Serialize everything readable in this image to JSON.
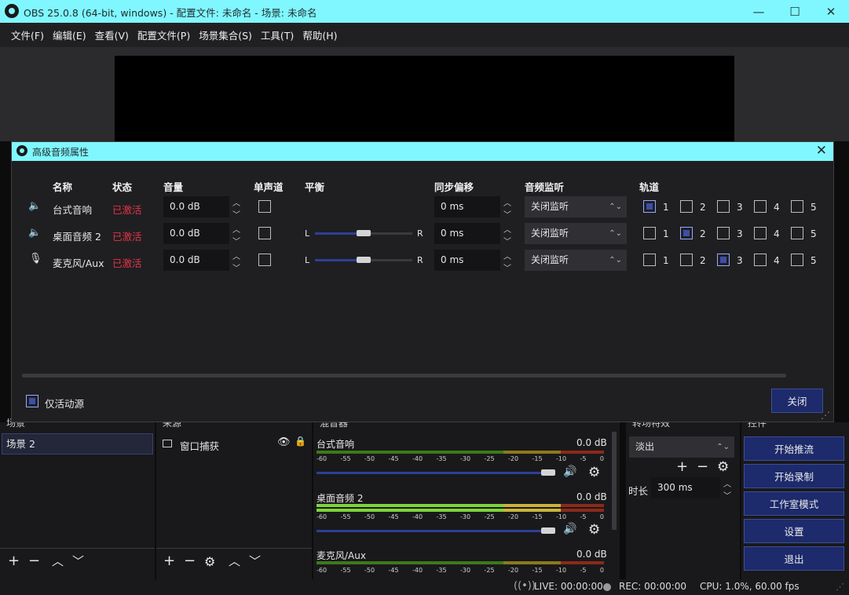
{
  "window": {
    "title": "OBS 25.0.8 (64-bit, windows) - 配置文件: 未命名 - 场景: 未命名",
    "minimize": "—",
    "maximize": "☐",
    "close": "✕"
  },
  "menu": [
    "文件(F)",
    "编辑(E)",
    "查看(V)",
    "配置文件(P)",
    "场景集合(S)",
    "工具(T)",
    "帮助(H)"
  ],
  "dialog": {
    "title": "高级音频属性",
    "close_icon": "✕",
    "headers": {
      "name": "名称",
      "status": "状态",
      "volume": "音量",
      "mono": "单声道",
      "balance": "平衡",
      "sync": "同步偏移",
      "monitoring": "音频监听",
      "tracks": "轨道"
    },
    "rows": [
      {
        "icon": "speaker-icon",
        "name": "台式音响",
        "status": "已激活",
        "volume": "0.0 dB",
        "sync": "0 ms",
        "monitor": "关闭监听",
        "balance": false,
        "track_on": 1
      },
      {
        "icon": "speaker-icon",
        "name": "桌面音频 2",
        "status": "已激活",
        "volume": "0.0 dB",
        "sync": "0 ms",
        "monitor": "关闭监听",
        "balance": true,
        "track_on": 2
      },
      {
        "icon": "microphone-icon",
        "name": "麦克风/Aux",
        "status": "已激活",
        "volume": "0.0 dB",
        "sync": "0 ms",
        "monitor": "关闭监听",
        "balance": true,
        "track_on": 3
      }
    ],
    "balance_left": "L",
    "balance_right": "R",
    "track_labels": [
      "1",
      "2",
      "3",
      "4",
      "5"
    ],
    "active_only_label": "仅活动源",
    "close_button": "关闭"
  },
  "scenes": {
    "header": "场景",
    "items": [
      "场景 2"
    ]
  },
  "sources": {
    "header": "来源",
    "items": [
      "窗口捕获"
    ]
  },
  "mixer": {
    "header": "混音器",
    "channels": [
      {
        "name": "台式音响",
        "db": "0.0 dB",
        "level": 0.97
      },
      {
        "name": "桌面音频 2",
        "db": "0.0 dB",
        "level": 0.97
      },
      {
        "name": "麦克风/Aux",
        "db": "0.0 dB",
        "level": 0.97
      }
    ],
    "scale": [
      "-60",
      "-55",
      "-50",
      "-45",
      "-40",
      "-35",
      "-30",
      "-25",
      "-20",
      "-15",
      "-10",
      "-5",
      "0"
    ]
  },
  "transitions": {
    "header": "转场特效",
    "selected": "淡出",
    "duration_label": "时长",
    "duration": "300 ms"
  },
  "controls": {
    "header": "控件",
    "buttons": [
      "开始推流",
      "开始录制",
      "工作室模式",
      "设置",
      "退出"
    ]
  },
  "statusbar": {
    "live": "LIVE: 00:00:00",
    "rec": "REC: 00:00:00",
    "cpu": "CPU: 1.0%, 60.00 fps"
  },
  "colors": {
    "accent": "#80f7ff",
    "active_status": "#e5334a",
    "button": "#1d2a6b"
  }
}
